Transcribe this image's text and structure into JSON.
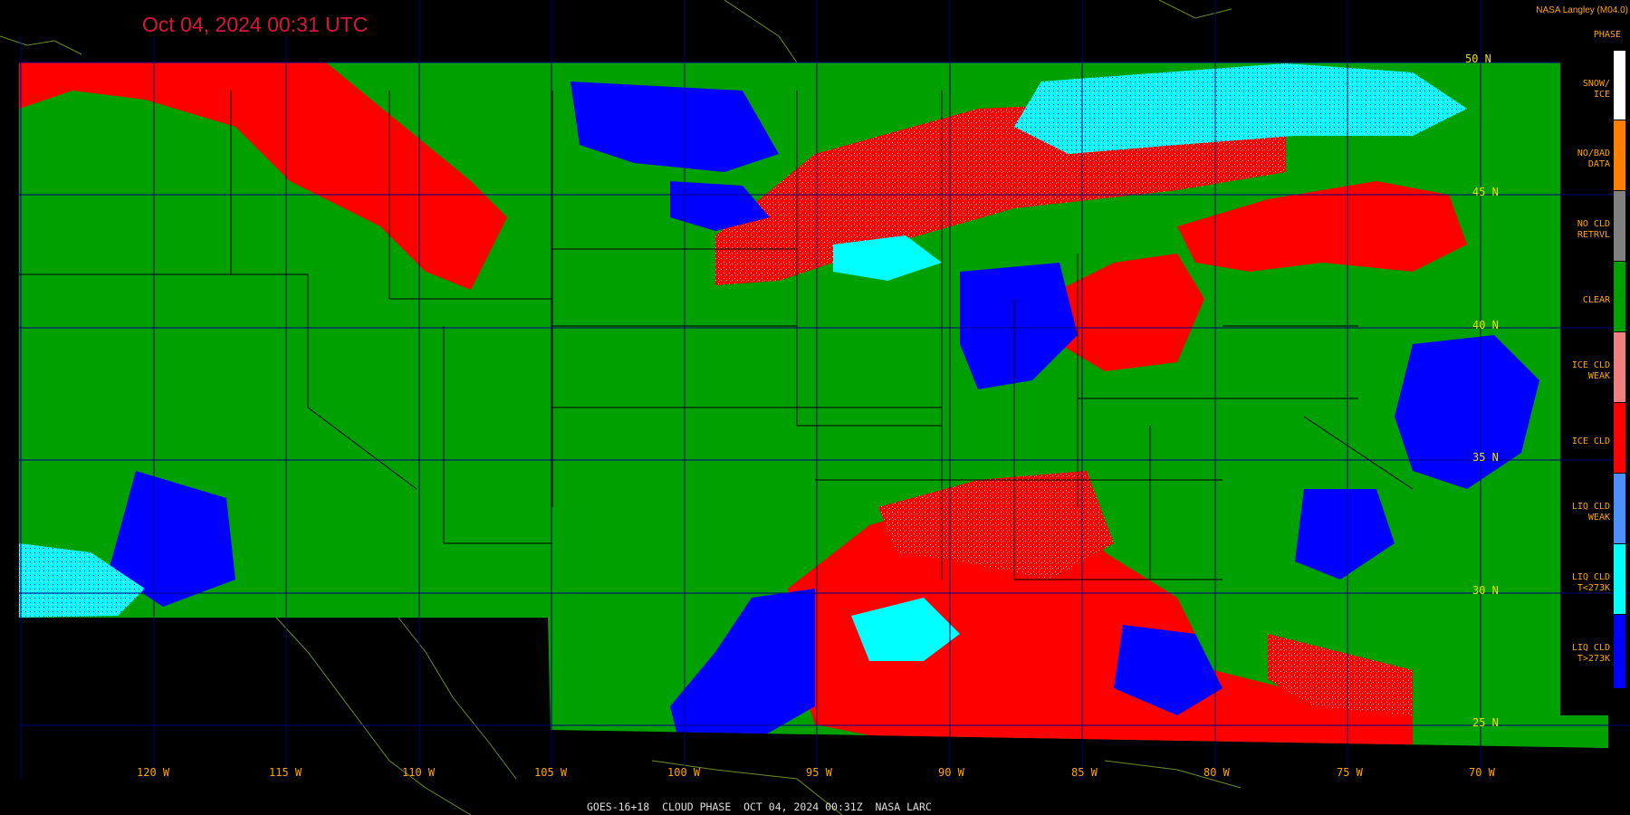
{
  "header": {
    "title": "Oct 04, 2024 00:31 UTC",
    "credit": "NASA Langley (M04.0)",
    "legend_title": "PHASE"
  },
  "footer": {
    "caption": "GOES-16+18  CLOUD PHASE  OCT 04, 2024 00:31Z  NASA LARC"
  },
  "axes": {
    "longitude_labels": [
      "120 W",
      "115 W",
      "110 W",
      "105 W",
      "100 W",
      "95 W",
      "90 W",
      "85 W",
      "80 W",
      "75 W",
      "70 W"
    ],
    "latitude_labels": [
      "50 N",
      "45 N",
      "40 N",
      "35 N",
      "30 N",
      "25 N"
    ]
  },
  "legend": [
    {
      "label": "SNOW/\nICE",
      "color": "#ffffff"
    },
    {
      "label": "NO/BAD\nDATA",
      "color": "#ff7f00"
    },
    {
      "label": "NO CLD\nRETRVL",
      "color": "#808080"
    },
    {
      "label": "CLEAR",
      "color": "#00a000"
    },
    {
      "label": "ICE CLD\nWEAK",
      "color": "#f08080"
    },
    {
      "label": "ICE CLD",
      "color": "#ff0000"
    },
    {
      "label": "LIQ CLD\nWEAK",
      "color": "#4a90ff"
    },
    {
      "label": "LIQ CLD\nT<273K",
      "color": "#00ffff"
    },
    {
      "label": "LIQ CLD\nT>273K",
      "color": "#0000ff"
    }
  ],
  "colors": {
    "clear": "#00a000",
    "ice": "#ff0000",
    "liquid_warm": "#0000ff",
    "liquid_cold": "#00ffff",
    "grid": "#000080",
    "coastline": "#6b8e23",
    "borders": "#000000"
  }
}
